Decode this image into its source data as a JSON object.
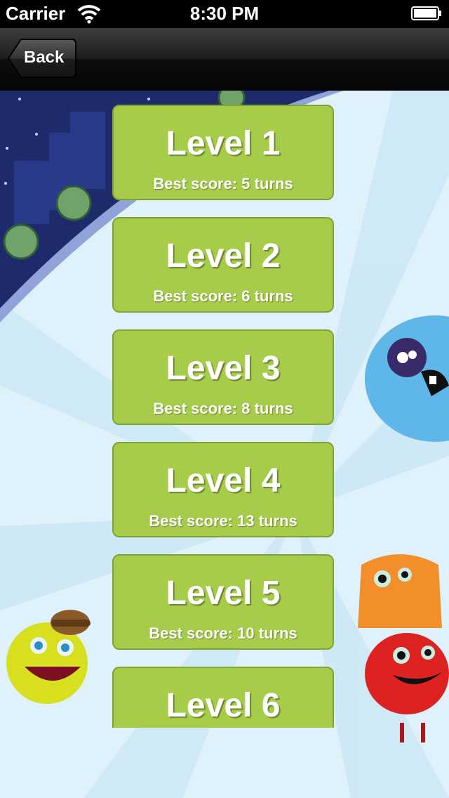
{
  "status_bar": {
    "carrier": "Carrier",
    "time": "8:30 PM",
    "icons": [
      "wifi-icon",
      "battery-icon"
    ]
  },
  "nav": {
    "back_label": "Back"
  },
  "levels": [
    {
      "title": "Level 1",
      "score": "Best score: 5 turns"
    },
    {
      "title": "Level 2",
      "score": "Best score: 6 turns"
    },
    {
      "title": "Level 3",
      "score": "Best score: 8 turns"
    },
    {
      "title": "Level 4",
      "score": "Best score: 13 turns"
    },
    {
      "title": "Level 5",
      "score": "Best score: 10 turns"
    },
    {
      "title": "Level 6",
      "score": ""
    }
  ],
  "colors": {
    "button_fill": "#a7cc4a",
    "button_border": "#7fa430",
    "background": "#dff1fa",
    "night_sky": "#1f2a6b"
  }
}
